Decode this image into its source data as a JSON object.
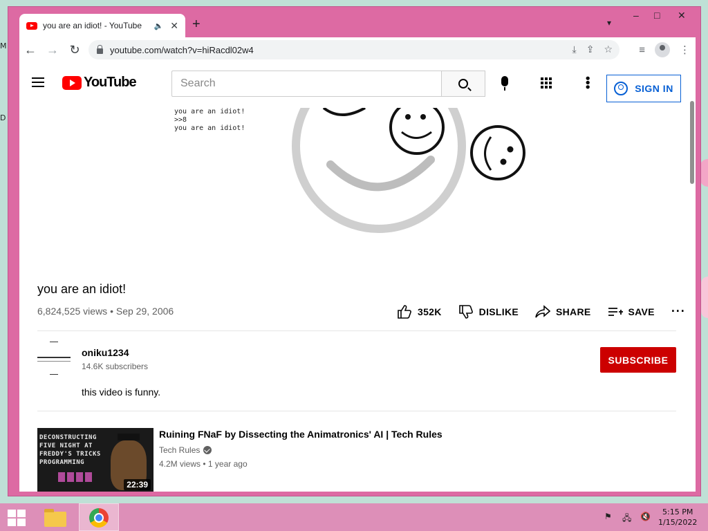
{
  "browser": {
    "tab_title": "you are an idiot! - YouTube",
    "url": "youtube.com/watch?v=hiRacdl02w4",
    "new_tab": "+",
    "win_minimize": "–",
    "win_maximize": "□",
    "win_close": "✕"
  },
  "youtube": {
    "logo_text": "YouTube",
    "search_placeholder": "Search",
    "sign_in": "SIGN IN"
  },
  "video": {
    "terminal_text": "you are an idiot!\n>>8\nyou are an idiot!",
    "title": "you are an idiot!",
    "views": "6,824,525 views",
    "date": "Sep 29, 2006",
    "likes": "352K",
    "dislike": "DISLIKE",
    "share": "SHARE",
    "save": "SAVE"
  },
  "channel": {
    "name": "oniku1234",
    "subscribers": "14.6K subscribers",
    "subscribe": "SUBSCRIBE",
    "description": "this video is funny."
  },
  "recommendations": [
    {
      "title": "Ruining FNaF by Dissecting the Animatronics' AI | Tech Rules",
      "channel": "Tech Rules",
      "views": "4.2M views",
      "age": "1 year ago",
      "duration": "22:39",
      "thumb_text": "DECONSTRUCTING\nFIVE NIGHT AT\nFREDDY'S TRICKS\nPROGRAMMING"
    }
  ],
  "taskbar": {
    "time": "5:15 PM",
    "date": "1/15/2022"
  },
  "colors": {
    "window_frame": "#dd6aa3",
    "taskbar": "#dd8fb8",
    "youtube_red": "#ff0000",
    "subscribe_red": "#cc0000",
    "link_blue": "#065fd4"
  }
}
